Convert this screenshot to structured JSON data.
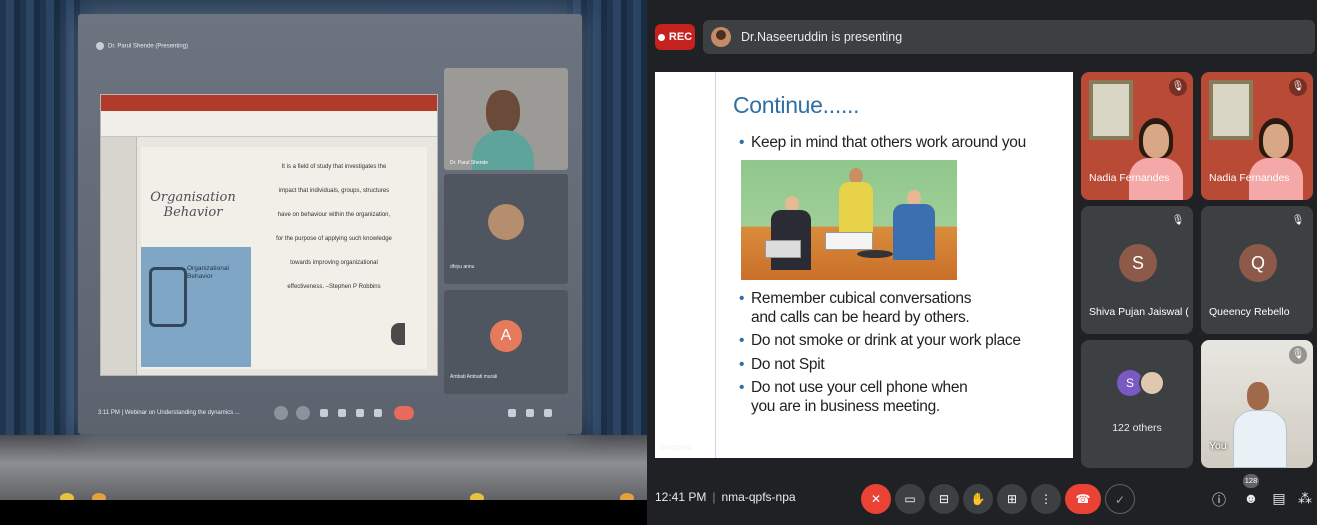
{
  "projection": {
    "presenter_label": "Dr. Parul Shende (Presenting)",
    "slide_title": "Organisation Behavior",
    "book_title": "Organizational Behavior",
    "slide_text": [
      "It is a field of study that investigates the",
      "impact that individuals, groups, structures",
      "have on behaviour within the organization,",
      "for the purpose of applying such knowledge",
      "towards improving organizational",
      "effectiveness. –Stephen P Robbins"
    ],
    "tiles": [
      "Dr. Parul Shende",
      "dhiyu annu",
      "Ambati Ambati murali"
    ],
    "tile3_letter": "A",
    "bottom_label": "3:11 PM  |  Webinar on Understanding the dynamics ..."
  },
  "meet": {
    "rec_label": "REC",
    "presenting_text": "Dr.Naseeruddin is presenting",
    "slide": {
      "title": "Continue......",
      "bullet_top": "Keep in mind that others work around you",
      "bullets": [
        "Remember cubical conversations and calls can be heard by others.",
        "Do not smoke or drink at your work place",
        "Do not Spit",
        "Do not use your cell phone when you are in business meeting."
      ]
    },
    "participants": [
      {
        "name": "Nadia Fernandes",
        "type": "video"
      },
      {
        "name": "Nadia Fernandes",
        "type": "video"
      },
      {
        "name": "Shiva Pujan Jaiswal (SUSE...",
        "letter": "S",
        "color": "#8d5a4a"
      },
      {
        "name": "Queency Rebello",
        "letter": "Q",
        "color": "#8d5a4a"
      },
      {
        "name": "122 others",
        "letter": "S"
      },
      {
        "name": "You",
        "type": "video"
      }
    ],
    "controls": {
      "time": "12:41 PM",
      "meeting_code": "nma-qpfs-npa",
      "participant_count": "128"
    },
    "icons": {
      "mic": "mic-off-icon",
      "cam": "camera-icon",
      "cc": "captions-icon",
      "hand": "raise-hand-icon",
      "present": "present-icon",
      "more": "more-vert-icon",
      "leave": "call-end-icon",
      "info": "info-icon",
      "people": "people-icon",
      "chat": "chat-icon",
      "activities": "activities-icon"
    },
    "colors": {
      "rec": "#c5221f",
      "leave": "#ea4335",
      "slide_title": "#2f6fa3"
    }
  }
}
